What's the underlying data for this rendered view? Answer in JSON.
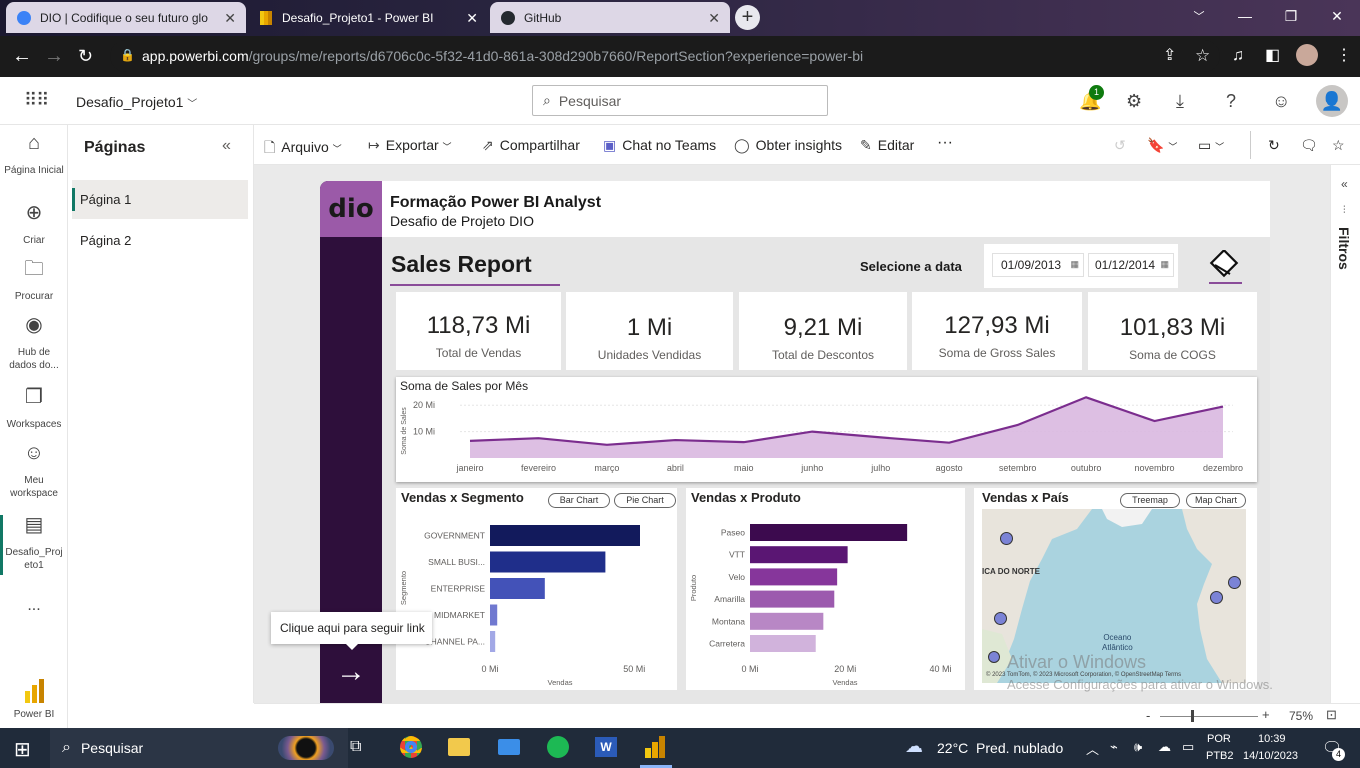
{
  "browser": {
    "tabs": [
      {
        "title": "DIO | Codifique o seu futuro glo",
        "icon": "dio-icon"
      },
      {
        "title": "Desafio_Projeto1 - Power BI",
        "icon": "powerbi-icon"
      },
      {
        "title": "GitHub",
        "icon": "github-icon"
      }
    ],
    "url_host": "app.powerbi.com",
    "url_path": "/groups/me/reports/d6706c0c-5f32-41d0-861a-308d290b7660/ReportSection?experience=power-bi"
  },
  "header": {
    "workspace_title": "Desafio_Projeto1",
    "search_placeholder": "Pesquisar",
    "notification_count": "1"
  },
  "leftnav": {
    "items": [
      {
        "label": "Página Inicial"
      },
      {
        "label": "Criar"
      },
      {
        "label": "Procurar"
      },
      {
        "label": "Hub de dados do..."
      },
      {
        "label": "Workspaces"
      },
      {
        "label": "Meu workspace"
      },
      {
        "label": "Desafio_Projeto1"
      },
      {
        "label": "..."
      }
    ],
    "bottom_label": "Power BI"
  },
  "pages_pane": {
    "title": "Páginas",
    "pages": [
      "Página 1",
      "Página 2"
    ]
  },
  "toolbar": {
    "arquivo": "Arquivo",
    "exportar": "Exportar",
    "compartilhar": "Compartilhar",
    "chat": "Chat no Teams",
    "insights": "Obter insights",
    "editar": "Editar",
    "more": "···"
  },
  "filters_label": "Filtros",
  "report": {
    "logo": "dio",
    "title": "Formação Power BI Analyst",
    "subtitle": "Desafio de Projeto DIO",
    "sales_report": "Sales Report",
    "date_label": "Selecione a data",
    "date_start": "01/09/2013",
    "date_end": "01/12/2014",
    "kpis": [
      {
        "value": "118,73 Mi",
        "label": "Total de Vendas"
      },
      {
        "value": "1 Mi",
        "label": "Unidades Vendidas"
      },
      {
        "value": "9,21 Mi",
        "label": "Total de Descontos"
      },
      {
        "value": "127,93 Mi",
        "label": "Soma de Gross Sales"
      },
      {
        "value": "101,83 Mi",
        "label": "Soma de COGS"
      }
    ],
    "tooltip": "Clique aqui para seguir link",
    "segment_pills": [
      "Bar Chart",
      "Pie Chart"
    ],
    "country_pills": [
      "Treemap",
      "Map Chart"
    ],
    "map": {
      "title": "Vendas x País",
      "label_na": "ICA DO NORTE",
      "label_ocean": "Oceano\nAtlântico",
      "credits": "© 2023 TomTom, © 2023 Microsoft Corporation, © OpenStreetMap  Terms"
    }
  },
  "chart_data": [
    {
      "type": "area",
      "title": "Soma de Sales por Mês",
      "ylabel": "Soma de Sales",
      "categories": [
        "janeiro",
        "fevereiro",
        "março",
        "abril",
        "maio",
        "junho",
        "julho",
        "agosto",
        "setembro",
        "outubro",
        "novembro",
        "dezembro"
      ],
      "values": [
        6.5,
        7.5,
        5.0,
        6.8,
        6.0,
        10.0,
        7.8,
        5.8,
        12.5,
        23.0,
        14.0,
        19.5
      ],
      "yticks": [
        "10 Mi",
        "20 Mi"
      ],
      "ylim": [
        0,
        25
      ]
    },
    {
      "type": "bar",
      "title": "Vendas x Segmento",
      "ylabel": "Segmento",
      "xlabel": "Vendas",
      "categories": [
        "GOVERNMENT",
        "SMALL BUSI...",
        "ENTERPRISE",
        "MIDMARKET",
        "CHANNEL PA..."
      ],
      "values": [
        52,
        40,
        19,
        2.5,
        1.8
      ],
      "xticks": [
        "0 Mi",
        "50 Mi"
      ],
      "xlim": [
        0,
        52
      ]
    },
    {
      "type": "bar",
      "title": "Vendas x Produto",
      "ylabel": "Produto",
      "xlabel": "Vendas",
      "categories": [
        "Paseo",
        "VTT",
        "Velo",
        "Amarilla",
        "Montana",
        "Carretera"
      ],
      "values": [
        33,
        20.5,
        18.3,
        17.7,
        15.4,
        13.8
      ],
      "xticks": [
        "0 Mi",
        "20 Mi",
        "40 Mi"
      ],
      "xlim": [
        0,
        42
      ]
    }
  ],
  "status": {
    "zoom": "75%"
  },
  "watermark": {
    "line1": "Ativar o Windows",
    "line2": "Acesse Configurações para ativar o Windows."
  },
  "taskbar": {
    "search": "Pesquisar",
    "weather": "22°C  Pred. nublado",
    "lang1": "POR",
    "lang2": "PTB2",
    "time": "10:39",
    "date": "14/10/2023",
    "notif": "4"
  }
}
